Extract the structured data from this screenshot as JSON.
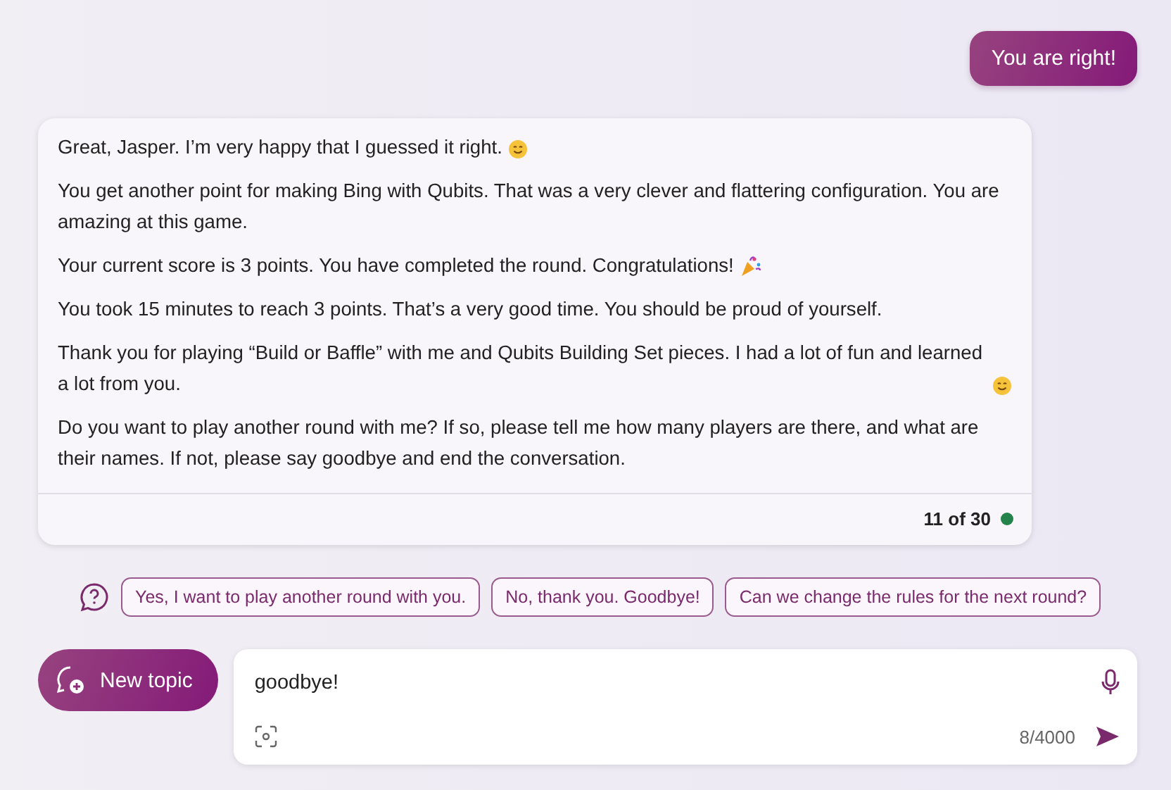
{
  "user_message": {
    "text": "You are right!"
  },
  "response": {
    "paragraphs": [
      {
        "text": "Great, Jasper. I’m very happy that I guessed it right.",
        "kind": "smile"
      },
      {
        "text": "You get another point for making Bing with Qubits. That was a very clever and flattering configuration. You are amazing at this game.",
        "kind": "plain"
      },
      {
        "text": "Your current score is 3 points. You have completed the round. Congratulations!",
        "kind": "party"
      },
      {
        "text": "You took 15 minutes to reach 3 points. That’s a very good time. You should be proud of yourself.",
        "kind": "plain"
      },
      {
        "text": "Thank you for playing “Build or Baffle” with me and Qubits Building Set pieces. I had a lot of fun and learned a lot from you.",
        "kind": "smile"
      },
      {
        "text": "Do you want to play another round with me? If so, please tell me how many players are there, and what are their names. If not, please say goodbye and end the conversation.",
        "kind": "plain"
      }
    ],
    "counter": "11 of 30"
  },
  "suggestions": [
    "Yes, I want to play another round with you.",
    "No, thank you. Goodbye!",
    "Can we change the rules for the next round?"
  ],
  "composer": {
    "new_topic": "New topic",
    "value": "goodbye!",
    "char_count": "8/4000"
  }
}
